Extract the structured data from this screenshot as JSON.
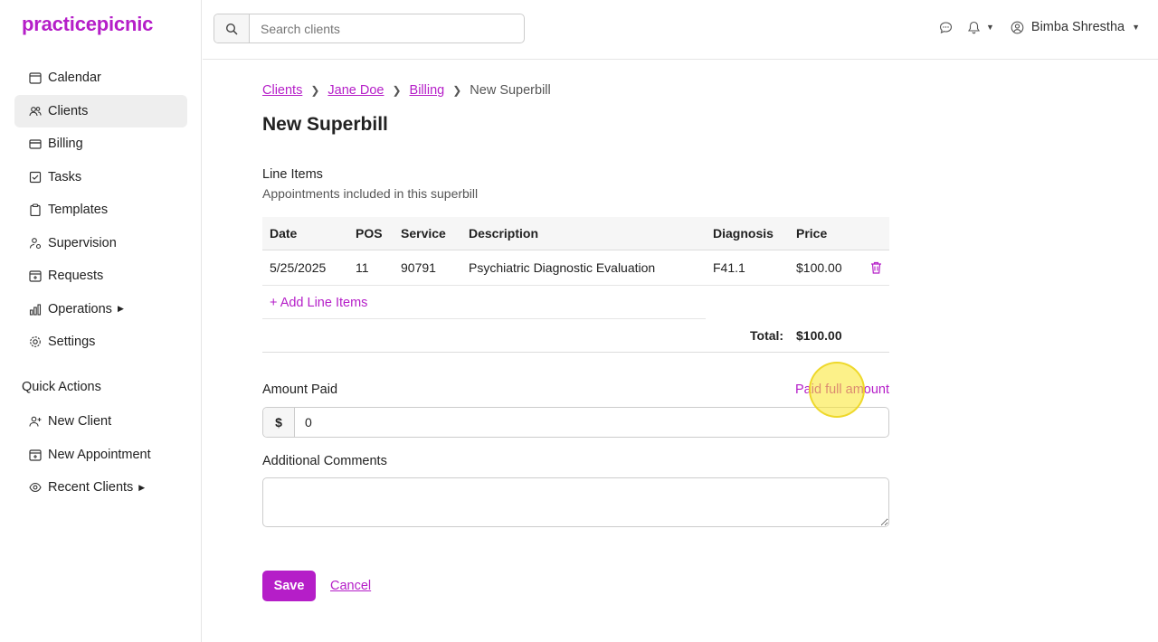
{
  "brand": {
    "name": "practicepicnic",
    "accent": "#b51ec8"
  },
  "sidebar": {
    "items": [
      {
        "label": "Calendar",
        "icon": "calendar-icon"
      },
      {
        "label": "Clients",
        "icon": "users-icon",
        "active": true
      },
      {
        "label": "Billing",
        "icon": "credit-card-icon"
      },
      {
        "label": "Tasks",
        "icon": "checkbox-icon"
      },
      {
        "label": "Templates",
        "icon": "clipboard-icon"
      },
      {
        "label": "Supervision",
        "icon": "user-gear-icon"
      },
      {
        "label": "Requests",
        "icon": "calendar-plus-icon"
      },
      {
        "label": "Operations",
        "icon": "bar-chart-icon",
        "caret": true
      },
      {
        "label": "Settings",
        "icon": "gear-icon"
      }
    ],
    "quick_actions_title": "Quick Actions",
    "quick_actions": [
      {
        "label": "New Client",
        "icon": "user-plus-icon"
      },
      {
        "label": "New Appointment",
        "icon": "calendar-plus-icon"
      },
      {
        "label": "Recent Clients",
        "icon": "eye-icon",
        "caret": true
      }
    ]
  },
  "topbar": {
    "search_placeholder": "Search clients",
    "user_name": "Bimba Shrestha"
  },
  "breadcrumb": {
    "items": [
      "Clients",
      "Jane Doe",
      "Billing"
    ],
    "current": "New Superbill"
  },
  "page": {
    "title": "New Superbill",
    "section_title": "Line Items",
    "section_subtitle": "Appointments included in this superbill"
  },
  "table": {
    "headers": {
      "date": "Date",
      "pos": "POS",
      "service": "Service",
      "description": "Description",
      "diagnosis": "Diagnosis",
      "price": "Price"
    },
    "rows": [
      {
        "date": "5/25/2025",
        "pos": "11",
        "service": "90791",
        "description": "Psychiatric Diagnostic Evaluation",
        "diagnosis": "F41.1",
        "price": "$100.00"
      }
    ],
    "add_label": "+ Add Line Items",
    "total_label": "Total:",
    "total_value": "$100.00"
  },
  "payment": {
    "amount_label": "Amount Paid",
    "paid_full_label": "Paid full amount",
    "currency_prefix": "$",
    "amount_value": "0"
  },
  "comments": {
    "label": "Additional Comments",
    "value": ""
  },
  "actions": {
    "save_label": "Save",
    "cancel_label": "Cancel"
  }
}
